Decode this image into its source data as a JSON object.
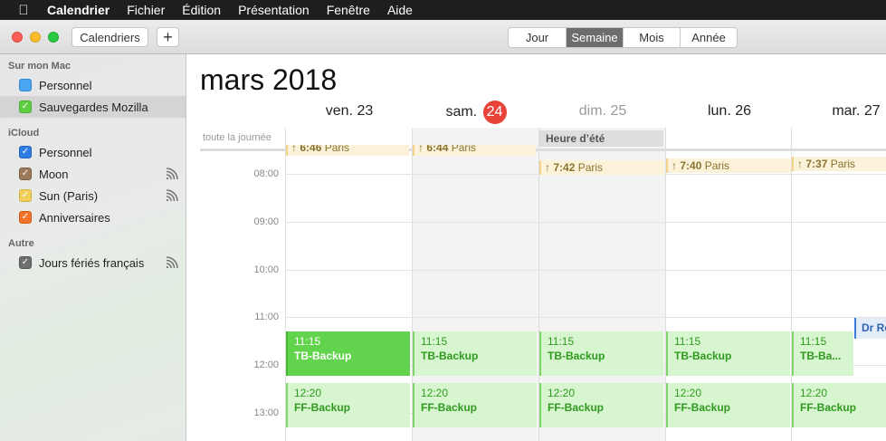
{
  "menubar": {
    "apple": "",
    "items": [
      "Calendrier",
      "Fichier",
      "Édition",
      "Présentation",
      "Fenêtre",
      "Aide"
    ]
  },
  "toolbar": {
    "calendars_button": "Calendriers",
    "add_button": "+",
    "views": [
      "Jour",
      "Semaine",
      "Mois",
      "Année"
    ],
    "active_view": "Semaine"
  },
  "sidebar": {
    "sections": [
      {
        "title": "Sur mon Mac",
        "items": [
          {
            "label": "Personnel",
            "checked": false,
            "color": "#4aa6f0",
            "shared": false,
            "selected": false
          },
          {
            "label": "Sauvegardes Mozilla",
            "checked": true,
            "color": "#5fce45",
            "shared": false,
            "selected": true
          }
        ]
      },
      {
        "title": "iCloud",
        "items": [
          {
            "label": "Personnel",
            "checked": true,
            "color": "#2f7de0",
            "shared": false,
            "selected": false
          },
          {
            "label": "Moon",
            "checked": true,
            "color": "#9c7a5b",
            "shared": true,
            "selected": false
          },
          {
            "label": "Sun (Paris)",
            "checked": true,
            "color": "#f2cf5a",
            "shared": true,
            "selected": false
          },
          {
            "label": "Anniversaires",
            "checked": true,
            "color": "#f2742c",
            "shared": false,
            "selected": false
          }
        ]
      },
      {
        "title": "Autre",
        "items": [
          {
            "label": "Jours fériés français",
            "checked": true,
            "color": "#6e6e6e",
            "shared": true,
            "selected": false
          }
        ]
      }
    ]
  },
  "main": {
    "month_title": "mars 2018",
    "days": [
      {
        "label": "ven. 23",
        "today": false,
        "dim": false
      },
      {
        "label": "sam.",
        "today_number": "24",
        "today": true,
        "dim": false
      },
      {
        "label": "dim. 25",
        "today": false,
        "dim": true
      },
      {
        "label": "lun. 26",
        "today": false,
        "dim": false
      },
      {
        "label": "mar. 27",
        "today": false,
        "dim": false
      }
    ],
    "allday_label": "toute la journée",
    "allday_event": "Heure d’été",
    "times": [
      "08:00",
      "09:00",
      "10:00",
      "11:00",
      "12:00",
      "13:00"
    ],
    "sunrise_cut": [
      {
        "arrow": "↑",
        "time": "6:46",
        "place": "Paris"
      },
      {
        "arrow": "↑",
        "time": "6:44",
        "place": "Paris"
      }
    ],
    "sunrise": [
      {
        "arrow": "↑",
        "time": "7:42",
        "place": "Paris"
      },
      {
        "arrow": "↑",
        "time": "7:40",
        "place": "Paris"
      },
      {
        "arrow": "↑",
        "time": "7:37",
        "place": "Paris"
      }
    ],
    "tb_events": [
      {
        "time": "11:15",
        "name": "TB-Backup"
      },
      {
        "time": "11:15",
        "name": "TB-Backup"
      },
      {
        "time": "11:15",
        "name": "TB-Backup"
      },
      {
        "time": "11:15",
        "name": "TB-Backup"
      },
      {
        "time": "11:15",
        "name": "TB-Ba..."
      }
    ],
    "ff_events": [
      {
        "time": "12:20",
        "name": "FF-Backup"
      },
      {
        "time": "12:20",
        "name": "FF-Backup"
      },
      {
        "time": "12:20",
        "name": "FF-Backup"
      },
      {
        "time": "12:20",
        "name": "FF-Backup"
      },
      {
        "time": "12:20",
        "name": "FF-Backup"
      }
    ],
    "blue_event": "Dr Re"
  }
}
